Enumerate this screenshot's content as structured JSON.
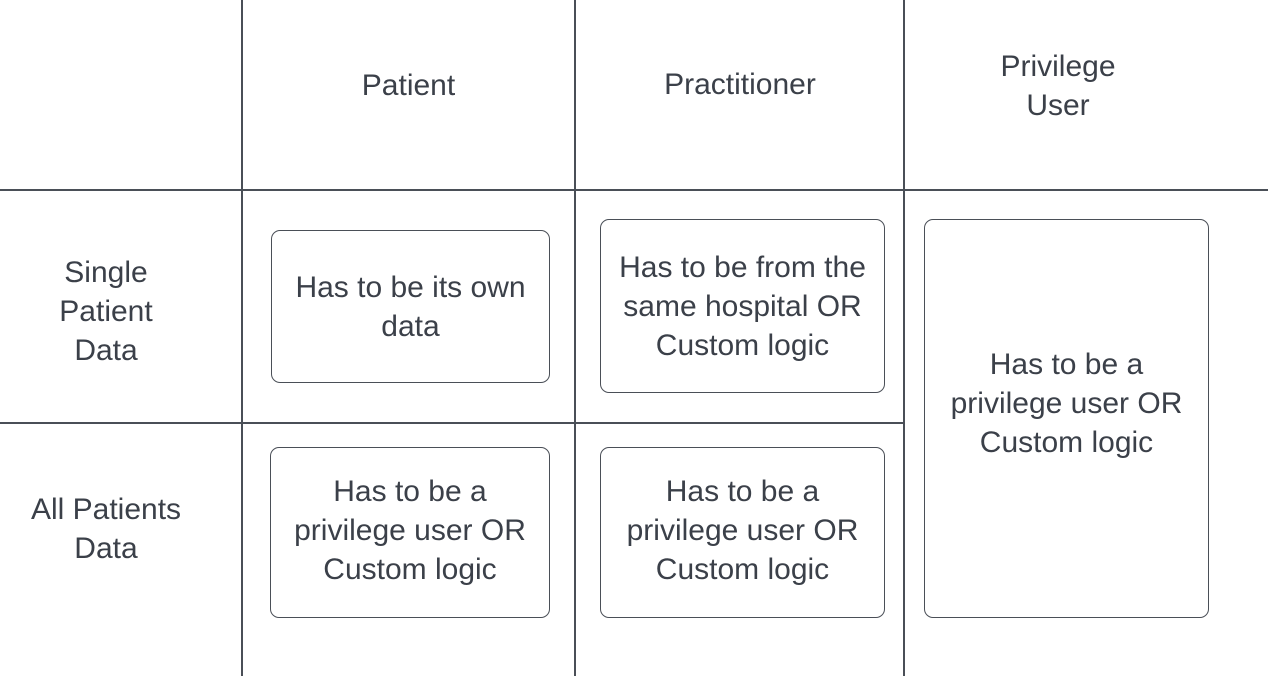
{
  "columns": {
    "patient": "Patient",
    "practitioner": "Practitioner",
    "privilege_user": "Privilege\nUser"
  },
  "rows": {
    "single": "Single\nPatient\nData",
    "all": "All Patients\nData"
  },
  "cells": {
    "patient_single": "Has to be its own\ndata",
    "practitioner_single": "Has to be from the\nsame hospital OR\nCustom logic",
    "privilege_user_any": "Has to be a\nprivilege user OR\nCustom logic",
    "patient_all": "Has to be a\nprivilege user OR\nCustom logic",
    "practitioner_all": "Has to be a\nprivilege user OR\nCustom logic"
  }
}
